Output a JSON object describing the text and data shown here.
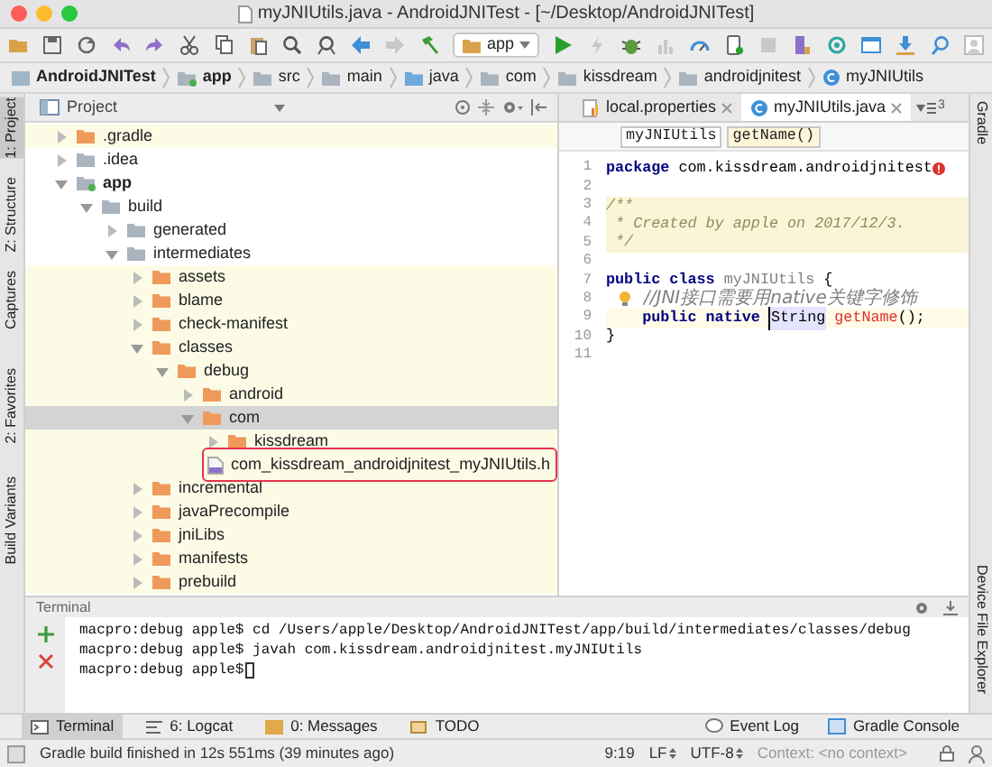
{
  "window": {
    "title": "myJNIUtils.java - AndroidJNITest - [~/Desktop/AndroidJNITest]"
  },
  "toolbar": {
    "run_config": "app"
  },
  "breadcrumbs": [
    {
      "label": "AndroidJNITest",
      "kind": "project"
    },
    {
      "label": "app",
      "kind": "module"
    },
    {
      "label": "src",
      "kind": "folder"
    },
    {
      "label": "main",
      "kind": "folder"
    },
    {
      "label": "java",
      "kind": "source"
    },
    {
      "label": "com",
      "kind": "folder"
    },
    {
      "label": "kissdream",
      "kind": "folder"
    },
    {
      "label": "androidjnitest",
      "kind": "folder"
    },
    {
      "label": "myJNIUtils",
      "kind": "class"
    }
  ],
  "left_strip": [
    {
      "label": "1: Project",
      "selected": true
    },
    {
      "label": "Z: Structure",
      "selected": false
    },
    {
      "label": "Captures",
      "selected": false
    },
    {
      "label": "2: Favorites",
      "selected": false
    },
    {
      "label": "Build Variants",
      "selected": false
    }
  ],
  "right_strip": [
    {
      "label": "Gradle"
    },
    {
      "label": "Device File Explorer"
    }
  ],
  "project_panel": {
    "title": "Project",
    "tree": [
      {
        "label": ".gradle",
        "kind": "folder",
        "expanded": false,
        "excluded": true,
        "selected": false,
        "marked": false
      },
      {
        "label": ".idea",
        "kind": "folder",
        "expanded": false,
        "excluded": false,
        "selected": false,
        "marked": false
      },
      {
        "label": "app",
        "kind": "module",
        "expanded": true,
        "excluded": false,
        "selected": false,
        "marked": false,
        "children": [
          {
            "label": "build",
            "kind": "folder",
            "expanded": true,
            "excluded": false,
            "selected": false,
            "marked": false,
            "children": [
              {
                "label": "generated",
                "kind": "folder",
                "expanded": false,
                "excluded": false,
                "selected": false,
                "marked": false
              },
              {
                "label": "intermediates",
                "kind": "folder",
                "expanded": true,
                "excluded": false,
                "selected": false,
                "marked": false,
                "children": [
                  {
                    "label": "assets",
                    "kind": "folder",
                    "expanded": false,
                    "excluded": true,
                    "selected": false,
                    "marked": false
                  },
                  {
                    "label": "blame",
                    "kind": "folder",
                    "expanded": false,
                    "excluded": true,
                    "selected": false,
                    "marked": false
                  },
                  {
                    "label": "check-manifest",
                    "kind": "folder",
                    "expanded": false,
                    "excluded": true,
                    "selected": false,
                    "marked": false
                  },
                  {
                    "label": "classes",
                    "kind": "folder",
                    "expanded": true,
                    "excluded": true,
                    "selected": false,
                    "marked": false,
                    "children": [
                      {
                        "label": "debug",
                        "kind": "folder",
                        "expanded": true,
                        "excluded": true,
                        "selected": false,
                        "marked": false,
                        "children": [
                          {
                            "label": "android",
                            "kind": "folder",
                            "expanded": false,
                            "excluded": true,
                            "selected": false,
                            "marked": false
                          },
                          {
                            "label": "com",
                            "kind": "folder",
                            "expanded": true,
                            "excluded": true,
                            "selected": true,
                            "marked": false,
                            "children": [
                              {
                                "label": "kissdream",
                                "kind": "folder",
                                "expanded": false,
                                "excluded": true,
                                "selected": false,
                                "marked": false
                              },
                              {
                                "label": "com_kissdream_androidjnitest_myJNIUtils.h",
                                "kind": "file",
                                "excluded": true,
                                "selected": false,
                                "marked": true
                              }
                            ]
                          }
                        ]
                      }
                    ]
                  },
                  {
                    "label": "incremental",
                    "kind": "folder",
                    "expanded": false,
                    "excluded": true,
                    "selected": false,
                    "marked": false
                  },
                  {
                    "label": "javaPrecompile",
                    "kind": "folder",
                    "expanded": false,
                    "excluded": true,
                    "selected": false,
                    "marked": false
                  },
                  {
                    "label": "jniLibs",
                    "kind": "folder",
                    "expanded": false,
                    "excluded": true,
                    "selected": false,
                    "marked": false
                  },
                  {
                    "label": "manifests",
                    "kind": "folder",
                    "expanded": false,
                    "excluded": true,
                    "selected": false,
                    "marked": false
                  },
                  {
                    "label": "prebuild",
                    "kind": "folder",
                    "expanded": false,
                    "excluded": true,
                    "selected": false,
                    "marked": false
                  }
                ]
              }
            ]
          }
        ]
      }
    ]
  },
  "editor": {
    "tabs": [
      {
        "label": "local.properties",
        "kind": "properties",
        "selected": false
      },
      {
        "label": "myJNIUtils.java",
        "kind": "class",
        "selected": true
      }
    ],
    "overflow_count": "3",
    "breadcrumbs": [
      "myJNIUtils",
      "getName()"
    ],
    "lines": [
      {
        "number": "1",
        "kind": "code",
        "current": false,
        "error": true,
        "hint": false,
        "segments": [
          {
            "kind": "keyword",
            "text": "package"
          },
          {
            "kind": "plain",
            "text": " com.kissdream.androidjnitest"
          }
        ]
      },
      {
        "number": "2",
        "kind": "code",
        "current": false,
        "error": false,
        "hint": false
      },
      {
        "number": "3",
        "kind": "doc",
        "current": false,
        "error": false,
        "hint": false,
        "segments": [
          {
            "kind": "doc",
            "text": "/**"
          }
        ]
      },
      {
        "number": "4",
        "kind": "doc",
        "current": false,
        "error": false,
        "hint": false,
        "segments": [
          {
            "kind": "doc",
            "text": " * Created by apple on 2017/12/3."
          }
        ]
      },
      {
        "number": "5",
        "kind": "doc",
        "current": false,
        "error": false,
        "hint": false,
        "segments": [
          {
            "kind": "doc",
            "text": " */"
          }
        ]
      },
      {
        "number": "6",
        "kind": "code",
        "current": false,
        "error": false,
        "hint": false
      },
      {
        "number": "7",
        "kind": "code",
        "current": false,
        "error": false,
        "hint": false,
        "segments": [
          {
            "kind": "keyword",
            "text": "public class "
          },
          {
            "kind": "unused",
            "text": "myJNIUtils"
          },
          {
            "kind": "plain",
            "text": " {"
          }
        ]
      },
      {
        "number": "8",
        "kind": "code",
        "current": false,
        "error": false,
        "hint": true,
        "segments": [
          {
            "kind": "comment",
            "text": "//JNI接口需要用native关键字修饰"
          }
        ]
      },
      {
        "number": "9",
        "kind": "code",
        "current": true,
        "error": false,
        "hint": false,
        "segments": [
          {
            "kind": "keyword",
            "text": "    public native "
          },
          {
            "kind": "usage",
            "text": "String"
          },
          {
            "kind": "error",
            "text": " getName"
          },
          {
            "kind": "plain",
            "text": "();"
          }
        ]
      },
      {
        "number": "10",
        "kind": "code",
        "current": false,
        "error": false,
        "hint": false,
        "segments": [
          {
            "kind": "plain",
            "text": "}"
          }
        ]
      },
      {
        "number": "11",
        "kind": "code",
        "current": false,
        "error": false,
        "hint": false
      }
    ]
  },
  "terminal": {
    "title": "Terminal",
    "cursor": true,
    "lines": [
      "macpro:debug apple$ cd /Users/apple/Desktop/AndroidJNITest/app/build/intermediates/classes/debug",
      "macpro:debug apple$ javah com.kissdream.androidjnitest.myJNIUtils",
      "macpro:debug apple$"
    ]
  },
  "tool_tabs": {
    "left": [
      {
        "label": "Terminal",
        "selected": true
      },
      {
        "label": "6: Logcat",
        "selected": false
      },
      {
        "label": "0: Messages",
        "selected": false
      },
      {
        "label": "TODO",
        "selected": false
      }
    ],
    "right": [
      {
        "label": "Event Log"
      },
      {
        "label": "Gradle Console"
      }
    ]
  },
  "status_bar": {
    "message": "Gradle build finished in 12s 551ms (39 minutes ago)",
    "position": "9:19",
    "line_separator": "LF",
    "encoding": "UTF-8",
    "context": "Context: <no context>"
  }
}
